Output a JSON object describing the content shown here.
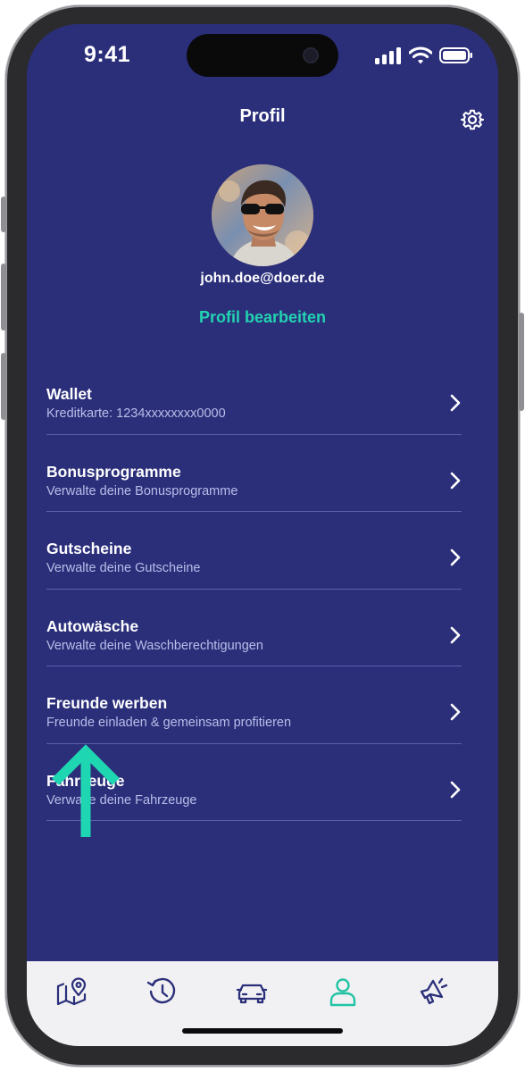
{
  "status_bar": {
    "time": "9:41"
  },
  "header": {
    "title": "Profil",
    "settings_icon": "gear-icon"
  },
  "profile": {
    "email": "john.doe@doer.de",
    "edit_label": "Profil bearbeiten"
  },
  "menu": {
    "items": [
      {
        "title": "Wallet",
        "subtitle": "Kreditkarte: 1234xxxxxxxx0000"
      },
      {
        "title": "Bonusprogramme",
        "subtitle": "Verwalte deine Bonusprogramme"
      },
      {
        "title": "Gutscheine",
        "subtitle": "Verwalte deine Gutscheine"
      },
      {
        "title": "Autowäsche",
        "subtitle": "Verwalte deine Waschberechtigungen"
      },
      {
        "title": "Freunde werben",
        "subtitle": "Freunde einladen & gemeinsam profitieren"
      },
      {
        "title": "Fahrzeuge",
        "subtitle": "Verwalte deine Fahrzeuge"
      }
    ]
  },
  "tabbar": {
    "tabs": [
      {
        "icon": "map-pin-icon",
        "active": false
      },
      {
        "icon": "history-icon",
        "active": false
      },
      {
        "icon": "car-icon",
        "active": false
      },
      {
        "icon": "profile-icon",
        "active": true
      },
      {
        "icon": "megaphone-icon",
        "active": false
      }
    ]
  },
  "colors": {
    "background": "#2b2f7a",
    "accent": "#22d3b1",
    "tab_icon": "#2b2f7a",
    "tabbar_bg": "#f1f1f3"
  }
}
